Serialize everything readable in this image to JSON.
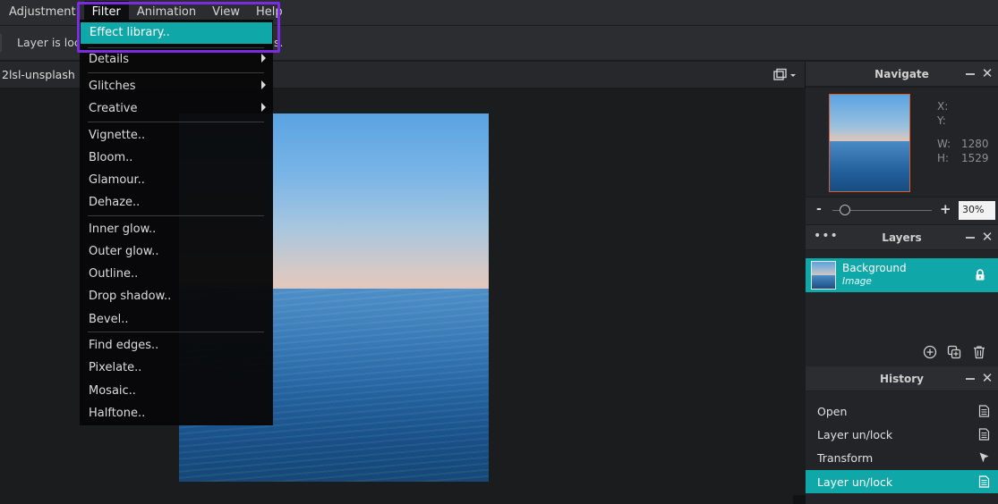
{
  "menubar": {
    "items": [
      "Adjustment",
      "Filter",
      "Animation",
      "View",
      "Help"
    ],
    "active": "Filter"
  },
  "toolbar": {
    "message_left": "Layer is locke",
    "message_right": "s."
  },
  "document": {
    "tab_name": "2lsl-unsplash"
  },
  "filter_menu": {
    "highlighted": "Effect library..",
    "items": [
      {
        "label": "Effect library..",
        "submenu": false
      },
      {
        "label": "Details",
        "submenu": true
      },
      {
        "label": "Glitches",
        "submenu": true
      },
      {
        "label": "Creative",
        "submenu": true
      },
      {
        "label": "Vignette..",
        "submenu": false
      },
      {
        "label": "Bloom..",
        "submenu": false
      },
      {
        "label": "Glamour..",
        "submenu": false
      },
      {
        "label": "Dehaze..",
        "submenu": false
      },
      {
        "label": "Inner glow..",
        "submenu": false
      },
      {
        "label": "Outer glow..",
        "submenu": false
      },
      {
        "label": "Outline..",
        "submenu": false
      },
      {
        "label": "Drop shadow..",
        "submenu": false
      },
      {
        "label": "Bevel..",
        "submenu": false
      },
      {
        "label": "Find edges..",
        "submenu": false
      },
      {
        "label": "Pixelate..",
        "submenu": false
      },
      {
        "label": "Mosaic..",
        "submenu": false
      },
      {
        "label": "Halftone..",
        "submenu": false
      }
    ]
  },
  "navigate": {
    "title": "Navigate",
    "x_label": "X:",
    "y_label": "Y:",
    "w_label": "W:",
    "h_label": "H:",
    "w_value": "1280",
    "h_value": "1529",
    "zoom_minus": "-",
    "zoom_plus": "+",
    "zoom_value": "30%"
  },
  "layers": {
    "title": "Layers",
    "items": [
      {
        "name": "Background",
        "type": "Image",
        "locked": true
      }
    ]
  },
  "history": {
    "title": "History",
    "items": [
      {
        "label": "Open",
        "icon": "document-icon"
      },
      {
        "label": "Layer un/lock",
        "icon": "document-icon"
      },
      {
        "label": "Transform",
        "icon": "pointer-icon"
      },
      {
        "label": "Layer un/lock",
        "icon": "document-icon"
      }
    ],
    "selected_index": 3
  },
  "colors": {
    "accent": "#0fa7a7",
    "annotation_box": "#7b2be0",
    "nav_frame": "#d85f32"
  }
}
